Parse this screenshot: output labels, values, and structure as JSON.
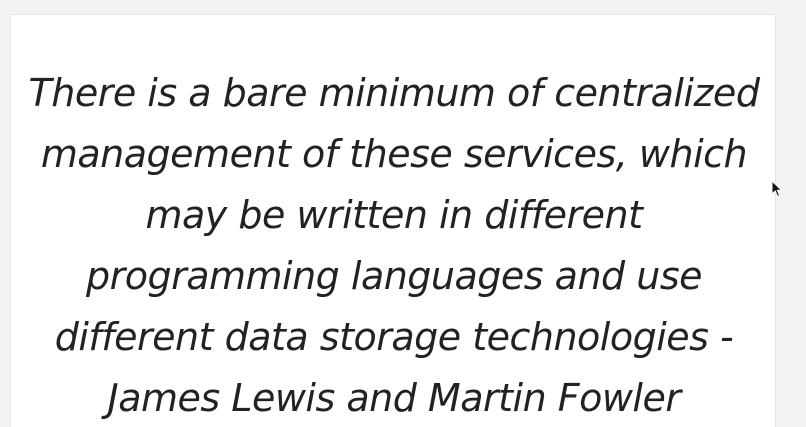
{
  "quote": {
    "lines": [
      "There is a bare minimum of centralized",
      "management of these services, which",
      "may be written in different",
      "programming languages and use",
      "different data storage technologies -",
      "James Lewis and Martin Fowler"
    ]
  },
  "colors": {
    "text": "#222222",
    "card_background": "#ffffff",
    "page_background": "#f3f3f3"
  },
  "icons": {
    "cursor": "mouse-pointer-icon"
  }
}
